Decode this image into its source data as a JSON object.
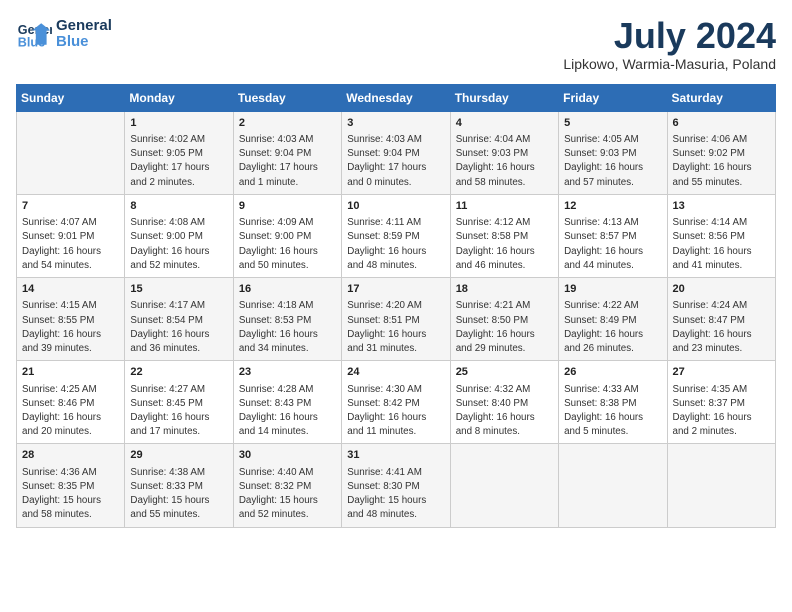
{
  "header": {
    "logo_line1": "General",
    "logo_line2": "Blue",
    "month_title": "July 2024",
    "location": "Lipkowo, Warmia-Masuria, Poland"
  },
  "columns": [
    "Sunday",
    "Monday",
    "Tuesday",
    "Wednesday",
    "Thursday",
    "Friday",
    "Saturday"
  ],
  "weeks": [
    [
      {
        "day": "",
        "content": ""
      },
      {
        "day": "1",
        "content": "Sunrise: 4:02 AM\nSunset: 9:05 PM\nDaylight: 17 hours\nand 2 minutes."
      },
      {
        "day": "2",
        "content": "Sunrise: 4:03 AM\nSunset: 9:04 PM\nDaylight: 17 hours\nand 1 minute."
      },
      {
        "day": "3",
        "content": "Sunrise: 4:03 AM\nSunset: 9:04 PM\nDaylight: 17 hours\nand 0 minutes."
      },
      {
        "day": "4",
        "content": "Sunrise: 4:04 AM\nSunset: 9:03 PM\nDaylight: 16 hours\nand 58 minutes."
      },
      {
        "day": "5",
        "content": "Sunrise: 4:05 AM\nSunset: 9:03 PM\nDaylight: 16 hours\nand 57 minutes."
      },
      {
        "day": "6",
        "content": "Sunrise: 4:06 AM\nSunset: 9:02 PM\nDaylight: 16 hours\nand 55 minutes."
      }
    ],
    [
      {
        "day": "7",
        "content": "Sunrise: 4:07 AM\nSunset: 9:01 PM\nDaylight: 16 hours\nand 54 minutes."
      },
      {
        "day": "8",
        "content": "Sunrise: 4:08 AM\nSunset: 9:00 PM\nDaylight: 16 hours\nand 52 minutes."
      },
      {
        "day": "9",
        "content": "Sunrise: 4:09 AM\nSunset: 9:00 PM\nDaylight: 16 hours\nand 50 minutes."
      },
      {
        "day": "10",
        "content": "Sunrise: 4:11 AM\nSunset: 8:59 PM\nDaylight: 16 hours\nand 48 minutes."
      },
      {
        "day": "11",
        "content": "Sunrise: 4:12 AM\nSunset: 8:58 PM\nDaylight: 16 hours\nand 46 minutes."
      },
      {
        "day": "12",
        "content": "Sunrise: 4:13 AM\nSunset: 8:57 PM\nDaylight: 16 hours\nand 44 minutes."
      },
      {
        "day": "13",
        "content": "Sunrise: 4:14 AM\nSunset: 8:56 PM\nDaylight: 16 hours\nand 41 minutes."
      }
    ],
    [
      {
        "day": "14",
        "content": "Sunrise: 4:15 AM\nSunset: 8:55 PM\nDaylight: 16 hours\nand 39 minutes."
      },
      {
        "day": "15",
        "content": "Sunrise: 4:17 AM\nSunset: 8:54 PM\nDaylight: 16 hours\nand 36 minutes."
      },
      {
        "day": "16",
        "content": "Sunrise: 4:18 AM\nSunset: 8:53 PM\nDaylight: 16 hours\nand 34 minutes."
      },
      {
        "day": "17",
        "content": "Sunrise: 4:20 AM\nSunset: 8:51 PM\nDaylight: 16 hours\nand 31 minutes."
      },
      {
        "day": "18",
        "content": "Sunrise: 4:21 AM\nSunset: 8:50 PM\nDaylight: 16 hours\nand 29 minutes."
      },
      {
        "day": "19",
        "content": "Sunrise: 4:22 AM\nSunset: 8:49 PM\nDaylight: 16 hours\nand 26 minutes."
      },
      {
        "day": "20",
        "content": "Sunrise: 4:24 AM\nSunset: 8:47 PM\nDaylight: 16 hours\nand 23 minutes."
      }
    ],
    [
      {
        "day": "21",
        "content": "Sunrise: 4:25 AM\nSunset: 8:46 PM\nDaylight: 16 hours\nand 20 minutes."
      },
      {
        "day": "22",
        "content": "Sunrise: 4:27 AM\nSunset: 8:45 PM\nDaylight: 16 hours\nand 17 minutes."
      },
      {
        "day": "23",
        "content": "Sunrise: 4:28 AM\nSunset: 8:43 PM\nDaylight: 16 hours\nand 14 minutes."
      },
      {
        "day": "24",
        "content": "Sunrise: 4:30 AM\nSunset: 8:42 PM\nDaylight: 16 hours\nand 11 minutes."
      },
      {
        "day": "25",
        "content": "Sunrise: 4:32 AM\nSunset: 8:40 PM\nDaylight: 16 hours\nand 8 minutes."
      },
      {
        "day": "26",
        "content": "Sunrise: 4:33 AM\nSunset: 8:38 PM\nDaylight: 16 hours\nand 5 minutes."
      },
      {
        "day": "27",
        "content": "Sunrise: 4:35 AM\nSunset: 8:37 PM\nDaylight: 16 hours\nand 2 minutes."
      }
    ],
    [
      {
        "day": "28",
        "content": "Sunrise: 4:36 AM\nSunset: 8:35 PM\nDaylight: 15 hours\nand 58 minutes."
      },
      {
        "day": "29",
        "content": "Sunrise: 4:38 AM\nSunset: 8:33 PM\nDaylight: 15 hours\nand 55 minutes."
      },
      {
        "day": "30",
        "content": "Sunrise: 4:40 AM\nSunset: 8:32 PM\nDaylight: 15 hours\nand 52 minutes."
      },
      {
        "day": "31",
        "content": "Sunrise: 4:41 AM\nSunset: 8:30 PM\nDaylight: 15 hours\nand 48 minutes."
      },
      {
        "day": "",
        "content": ""
      },
      {
        "day": "",
        "content": ""
      },
      {
        "day": "",
        "content": ""
      }
    ]
  ]
}
